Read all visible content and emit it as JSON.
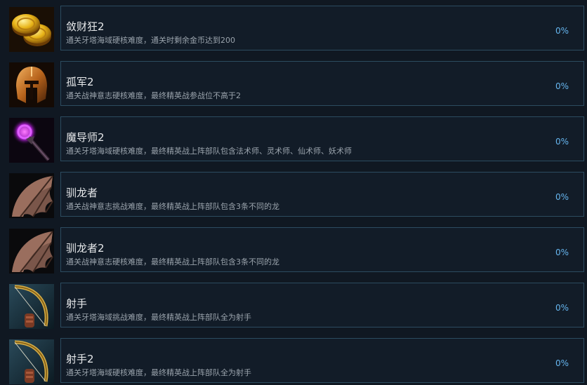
{
  "achievements": [
    {
      "icon": "gold-coins-icon",
      "title": "敛财狂2",
      "description": "通关牙塔海域硬核难度，通关时剩余金币达到200",
      "percent": "0%"
    },
    {
      "icon": "bronze-helmet-icon",
      "title": "孤军2",
      "description": "通关战神意志硬核难度，最终精英战参战位不高于2",
      "percent": "0%"
    },
    {
      "icon": "magic-staff-icon",
      "title": "魔导师2",
      "description": "通关牙塔海域硬核难度，最终精英战上阵部队包含法术师、灵术师、仙术师、妖术师",
      "percent": "0%"
    },
    {
      "icon": "dragon-wing-icon",
      "title": "驯龙者",
      "description": "通关战神意志挑战难度，最终精英战上阵部队包含3条不同的龙",
      "percent": "0%"
    },
    {
      "icon": "dragon-wing-icon",
      "title": "驯龙者2",
      "description": "通关战神意志硬核难度，最终精英战上阵部队包含3条不同的龙",
      "percent": "0%"
    },
    {
      "icon": "bow-icon",
      "title": "射手",
      "description": "通关牙塔海域挑战难度，最终精英战上阵部队全为射手",
      "percent": "0%"
    },
    {
      "icon": "bow-icon",
      "title": "射手2",
      "description": "通关牙塔海域硬核难度，最终精英战上阵部队全为射手",
      "percent": "0%"
    }
  ]
}
